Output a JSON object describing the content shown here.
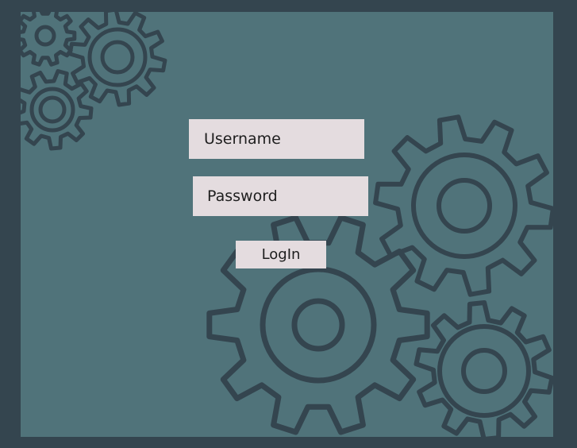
{
  "login_form": {
    "username_placeholder": "Username",
    "password_placeholder": "Password",
    "login_label": "LogIn"
  },
  "theme": {
    "frame": "#34454f",
    "background": "#50737a",
    "gear_stroke": "#34454f",
    "input_bg": "#e4dcdf",
    "text": "#1e1e1e"
  },
  "decoration": {
    "icon": "gear-icon"
  }
}
